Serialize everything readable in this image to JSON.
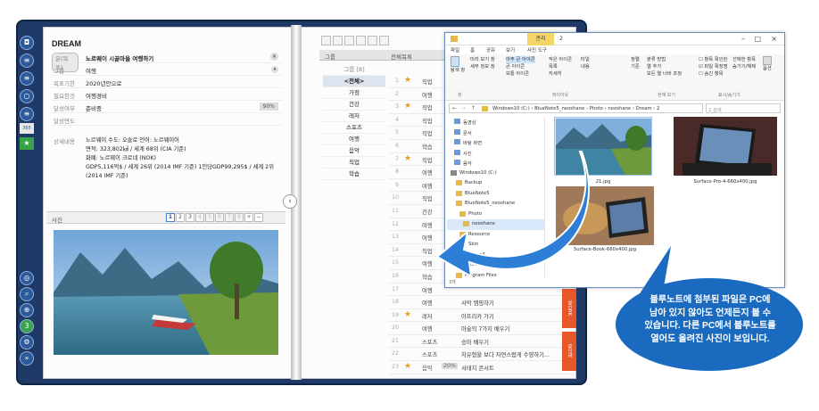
{
  "left_page": {
    "title": "DREAM",
    "header_label": "운(목표)",
    "header_value": "노르웨이 시골마을 여행하기",
    "rows": [
      {
        "label": "그룹",
        "value": "여행"
      },
      {
        "label": "목표기한",
        "value": "2020년안으로"
      },
      {
        "label": "필요한것",
        "value": "여행경비"
      },
      {
        "label": "달성여부",
        "value": "준비중",
        "pct": "90%"
      },
      {
        "label": "달성면도",
        "value": ""
      }
    ],
    "detail_label": "상세내용",
    "detail_lines": [
      "노르웨이 수도: 오슬로 언어: 노르웨이어",
      "면적: 323,802㎢ / 세계 68위 (CIA 기준)",
      "화폐: 노르웨이 크로네 (NOK)",
      "GDP5,116억$ / 세계 26위 (2014 IMF 기준) 1인당GDP99,295$ / 세계 2위 (2014 IMF 기준)"
    ],
    "photo_label": "사진",
    "pager": [
      "1",
      "2",
      "3",
      "4",
      "5",
      "6",
      "7",
      "8",
      "+",
      "−"
    ]
  },
  "right_page": {
    "head_group": "그룹",
    "head_all": "전체목록",
    "head_count": "그룹 [8]",
    "categories": [
      "<전체>",
      "가정",
      "건강",
      "레저",
      "스포츠",
      "여행",
      "음악",
      "직업",
      "학습"
    ],
    "tasks": [
      {
        "no": "1",
        "star": true,
        "cat": "직업",
        "pct": "",
        "txt": ""
      },
      {
        "no": "2",
        "star": false,
        "cat": "여행",
        "pct": "",
        "txt": ""
      },
      {
        "no": "3",
        "star": true,
        "cat": "직업",
        "pct": "",
        "txt": ""
      },
      {
        "no": "4",
        "star": false,
        "cat": "직업",
        "pct": "",
        "txt": ""
      },
      {
        "no": "5",
        "star": false,
        "cat": "직업",
        "pct": "",
        "txt": ""
      },
      {
        "no": "6",
        "star": false,
        "cat": "학습",
        "pct": "",
        "txt": ""
      },
      {
        "no": "7",
        "star": true,
        "cat": "직업",
        "pct": "",
        "txt": ""
      },
      {
        "no": "8",
        "star": false,
        "cat": "여행",
        "pct": "",
        "txt": ""
      },
      {
        "no": "9",
        "star": false,
        "cat": "여행",
        "pct": "",
        "txt": ""
      },
      {
        "no": "10",
        "star": false,
        "cat": "직업",
        "pct": "",
        "txt": ""
      },
      {
        "no": "11",
        "star": false,
        "cat": "건강",
        "pct": "",
        "txt": ""
      },
      {
        "no": "12",
        "star": false,
        "cat": "여행",
        "pct": "",
        "txt": ""
      },
      {
        "no": "13",
        "star": false,
        "cat": "여행",
        "pct": "",
        "txt": ""
      },
      {
        "no": "14",
        "star": false,
        "cat": "직업",
        "pct": "",
        "txt": ""
      },
      {
        "no": "15",
        "star": false,
        "cat": "여행",
        "pct": "",
        "txt": ""
      },
      {
        "no": "16",
        "star": false,
        "cat": "학습",
        "pct": "",
        "txt": ""
      },
      {
        "no": "17",
        "star": false,
        "cat": "여행",
        "pct": "",
        "txt": ""
      },
      {
        "no": "18",
        "star": false,
        "cat": "여행",
        "pct": "",
        "txt": "사막 캠핑하기"
      },
      {
        "no": "19",
        "star": true,
        "cat": "레저",
        "pct": "",
        "txt": "아프리카 가기"
      },
      {
        "no": "20",
        "star": false,
        "cat": "여행",
        "pct": "",
        "txt": "마술의 7가지 배우기"
      },
      {
        "no": "21",
        "star": false,
        "cat": "스포츠",
        "pct": "",
        "txt": "승마 배우기"
      },
      {
        "no": "22",
        "star": false,
        "cat": "스포츠",
        "pct": "",
        "txt": "자유형을 보다 자연스럽게 수영하기..."
      },
      {
        "no": "23",
        "star": true,
        "cat": "음악",
        "pct": "20%",
        "txt": "서태지 콘서트"
      }
    ],
    "side_tabs": [
      "WORK",
      "NOTE"
    ]
  },
  "explorer": {
    "manage_tab": "관리",
    "title_num": "2",
    "tabs": [
      "파일",
      "홈",
      "공유",
      "보기",
      "사진 도구"
    ],
    "ribbon": {
      "nav_pane": "탐색 창",
      "preview_pane": "미리 보기 창",
      "details_pane": "세부 정보 창",
      "layout_items": [
        "아주 큰 아이콘",
        "큰 아이콘",
        "보통 아이콘",
        "작은 아이콘",
        "목록",
        "자세히",
        "타일",
        "내용"
      ],
      "sort_label": "정렬 기준",
      "group_by": "분류 방법",
      "add_column": "열 추가",
      "fit_columns": "모든 열 너비 조정",
      "check_items": [
        "항목 확인란",
        "파일 확장명",
        "숨긴 항목"
      ],
      "hide_selected": "선택한 항목 숨기기/해제",
      "options": "옵션",
      "group_titles": [
        "창",
        "레이아웃",
        "현재 보기",
        "표시/숨기기"
      ]
    },
    "address": "Windows10 (C:) › BlueNote5_neoshane › Photo › neoshane › Dream › 2",
    "search_placeholder": "2 검색",
    "nav_items": [
      "동영상",
      "문서",
      "바탕 화면",
      "사진",
      "음악",
      "Windows10 (C:)",
      "Backup",
      "BlueNote5",
      "BlueNote5_neoshane",
      "Photo",
      "neoshane",
      "Resource",
      "Skin",
      "kktking4",
      "Microsoft",
      "Program Files"
    ],
    "status": "3개",
    "files": [
      "21.jpg",
      "Surface-Pro-4-660x400.jpg",
      "Surface-Book-660x400.jpg"
    ]
  },
  "callout": {
    "lines": [
      "블루노트에 첨부된 파일은 PC에",
      "남아 있지 않아도 언제든지 볼 수",
      "있습니다. 다른 PC에서 블루노트를",
      "열어도 올려진 사진이 보입니다."
    ]
  },
  "colors": {
    "book_cover": "#1f3a66",
    "callout_blue": "#1a6bc0",
    "manage_tab": "#f4d566",
    "side_tab": "#e8572a"
  }
}
